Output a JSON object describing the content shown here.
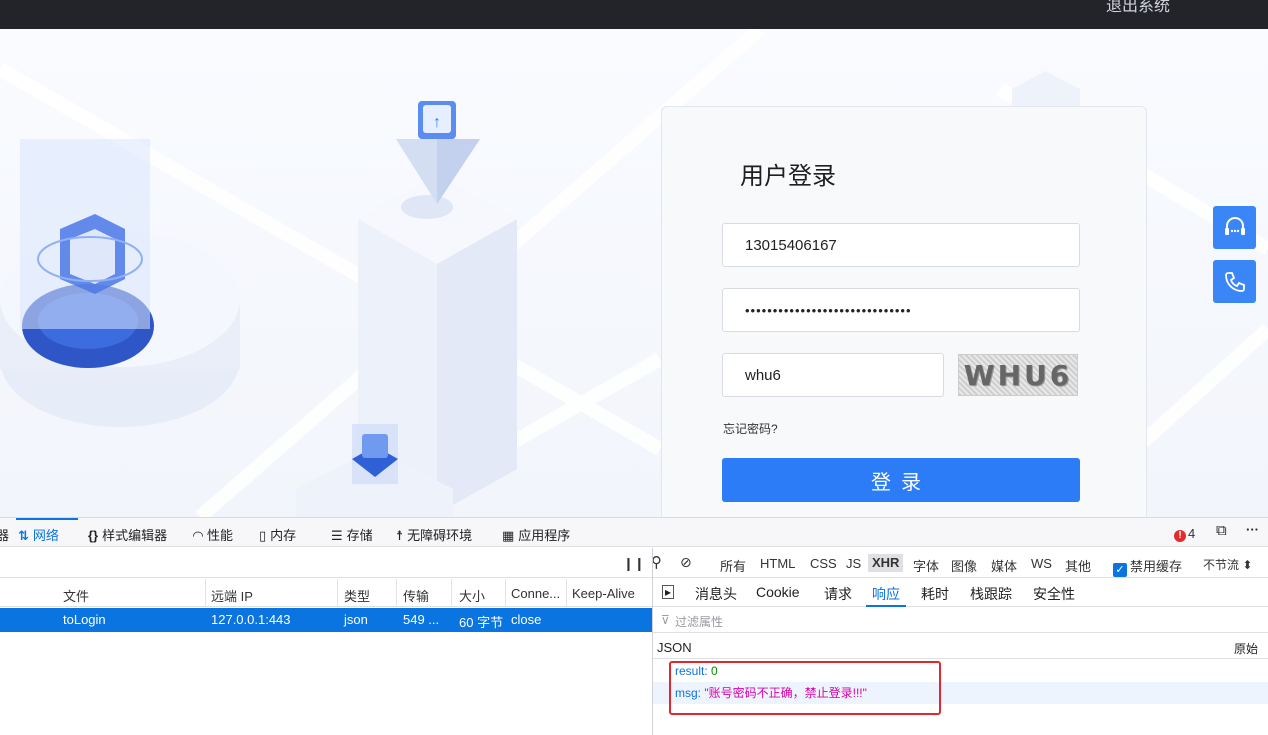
{
  "topbar": {
    "exit_label": "退出系统"
  },
  "login": {
    "title": "用户登录",
    "phone_value": "13015406167",
    "password_mask": "••••••••••••••••••••••••••••••",
    "code_value": "whu6",
    "captcha_text": "WHU6",
    "forgot_label": "忘记密码?",
    "submit_label": "登录"
  },
  "side": {
    "support_icon": "headset-icon",
    "phone_icon": "phone-icon"
  },
  "devtools": {
    "tabs": [
      {
        "icon": "⇅",
        "label": "网络"
      },
      {
        "icon": "{}",
        "label": "样式编辑器"
      },
      {
        "icon": "◠",
        "label": "性能"
      },
      {
        "icon": "▯",
        "label": "内存"
      },
      {
        "icon": "☰",
        "label": "存储"
      },
      {
        "icon": "☨",
        "label": "无障碍环境"
      },
      {
        "icon": "▦",
        "label": "应用程序"
      }
    ],
    "error_count": "4",
    "filters": [
      "所有",
      "HTML",
      "CSS",
      "JS",
      "XHR",
      "字体",
      "图像",
      "媒体",
      "WS",
      "其他"
    ],
    "selected_filter": "XHR",
    "disable_cache": "禁用缓存",
    "throttle": "不节流 ⬍",
    "columns": [
      "文件",
      "远端 IP",
      "类型",
      "传输",
      "大小",
      "Conne...",
      "Keep-Alive"
    ],
    "row": {
      "file": "toLogin",
      "ip": "127.0.0.1:443",
      "type": "json",
      "transfer": "549 ...",
      "size": "60 字节",
      "connection": "close"
    },
    "response_tabs": [
      "消息头",
      "Cookie",
      "请求",
      "响应",
      "耗时",
      "栈跟踪",
      "安全性"
    ],
    "active_response_tab": "响应",
    "filter_placeholder": "过滤属性",
    "json_label": "JSON",
    "raw_label": "原始",
    "json": {
      "key1": "result:",
      "val1": "0",
      "key2": "msg:",
      "val2": "\"账号密码不正确，禁止登录!!!\""
    }
  }
}
